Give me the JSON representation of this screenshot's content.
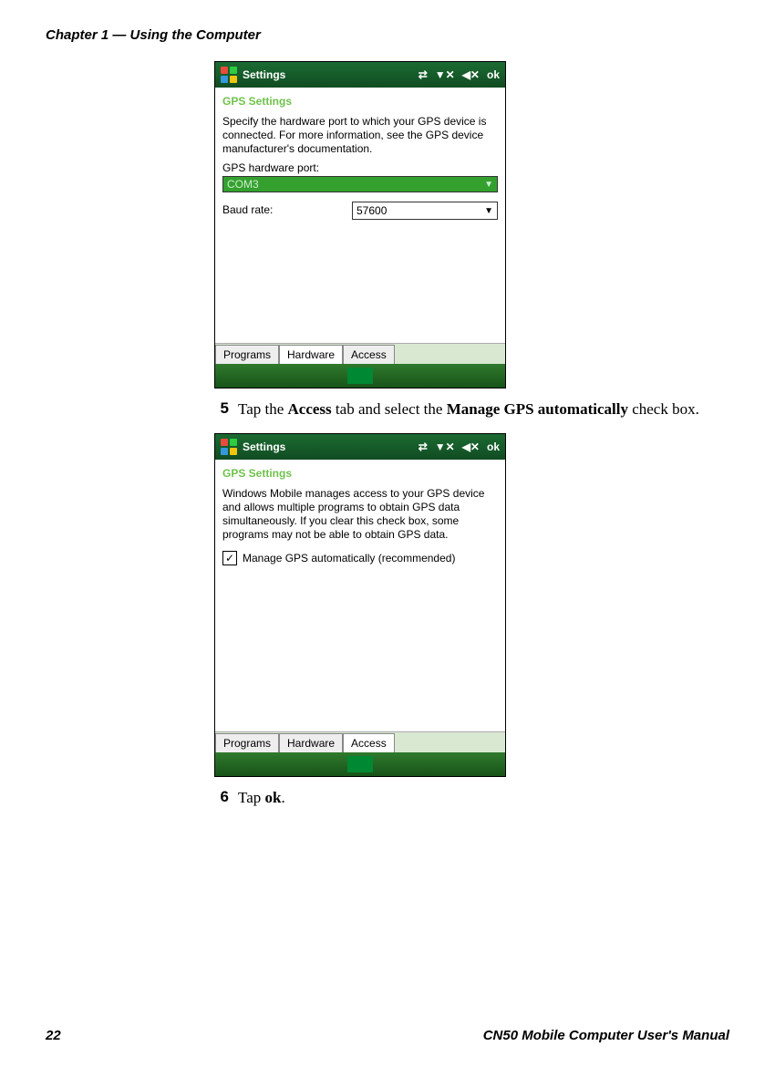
{
  "header": {
    "chapter": "Chapter 1 — Using the Computer"
  },
  "screen1": {
    "titlebar": {
      "title": "Settings",
      "ok": "ok"
    },
    "subtitle": "GPS Settings",
    "desc": "Specify the hardware port to which your GPS device is connected. For more information, see the GPS device manufacturer's documentation.",
    "port_label": "GPS hardware port:",
    "port_value": "COM3",
    "baud_label": "Baud rate:",
    "baud_value": "57600",
    "tabs": {
      "programs": "Programs",
      "hardware": "Hardware",
      "access": "Access"
    }
  },
  "step5": {
    "num": "5",
    "pre": "Tap the ",
    "b1": "Access",
    "mid": " tab and select the ",
    "b2": "Manage GPS automatically",
    "post": " check box."
  },
  "screen2": {
    "titlebar": {
      "title": "Settings",
      "ok": "ok"
    },
    "subtitle": "GPS Settings",
    "desc": "Windows Mobile manages access to your GPS device and allows multiple programs to obtain GPS data simultaneously. If you clear this check box, some programs may not be able to obtain GPS data.",
    "checkbox_label": "Manage GPS automatically (recommended)",
    "tabs": {
      "programs": "Programs",
      "hardware": "Hardware",
      "access": "Access"
    }
  },
  "step6": {
    "num": "6",
    "pre": "Tap ",
    "b1": "ok",
    "post": "."
  },
  "footer": {
    "page": "22",
    "manual": "CN50 Mobile Computer User's Manual"
  }
}
